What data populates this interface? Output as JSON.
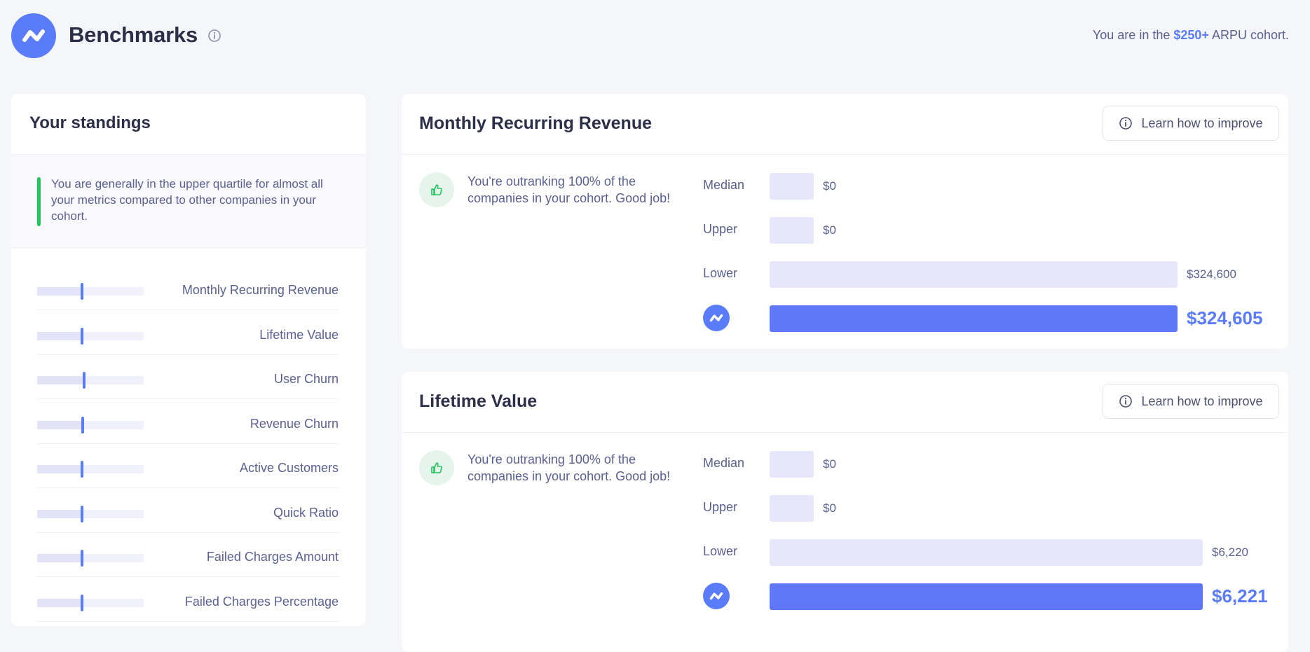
{
  "header": {
    "title": "Benchmarks",
    "cohort_prefix": "You are in the",
    "cohort_value": "$250+",
    "cohort_suffix": "ARPU cohort."
  },
  "standings": {
    "title": "Your standings",
    "summary": "You are generally in the upper quartile for almost all your metrics compared to other companies in your cohort.",
    "metrics": [
      {
        "label": "Monthly Recurring Revenue",
        "position": 0.42
      },
      {
        "label": "Lifetime Value",
        "position": 0.42
      },
      {
        "label": "User Churn",
        "position": 0.44
      },
      {
        "label": "Revenue Churn",
        "position": 0.43
      },
      {
        "label": "Active Customers",
        "position": 0.42
      },
      {
        "label": "Quick Ratio",
        "position": 0.42
      },
      {
        "label": "Failed Charges Amount",
        "position": 0.42
      },
      {
        "label": "Failed Charges Percentage",
        "position": 0.42
      }
    ]
  },
  "cards": [
    {
      "title": "Monthly Recurring Revenue",
      "improve_label": "Learn how to improve",
      "message": "You're outranking 100% of the companies in your cohort. Good job!",
      "median_label": "Median",
      "median_value": "$0",
      "upper_label": "Upper",
      "upper_value": "$0",
      "lower_label": "Lower",
      "lower_value": "$324,600",
      "you_value": "$324,605"
    },
    {
      "title": "Lifetime Value",
      "improve_label": "Learn how to improve",
      "message": "You're outranking 100% of the companies in your cohort. Good job!",
      "median_label": "Median",
      "median_value": "$0",
      "upper_label": "Upper",
      "upper_value": "$0",
      "lower_label": "Lower",
      "lower_value": "$6,220",
      "you_value": "$6,221"
    }
  ],
  "colors": {
    "accent": "#5b7cfa",
    "success": "#22c55e"
  }
}
